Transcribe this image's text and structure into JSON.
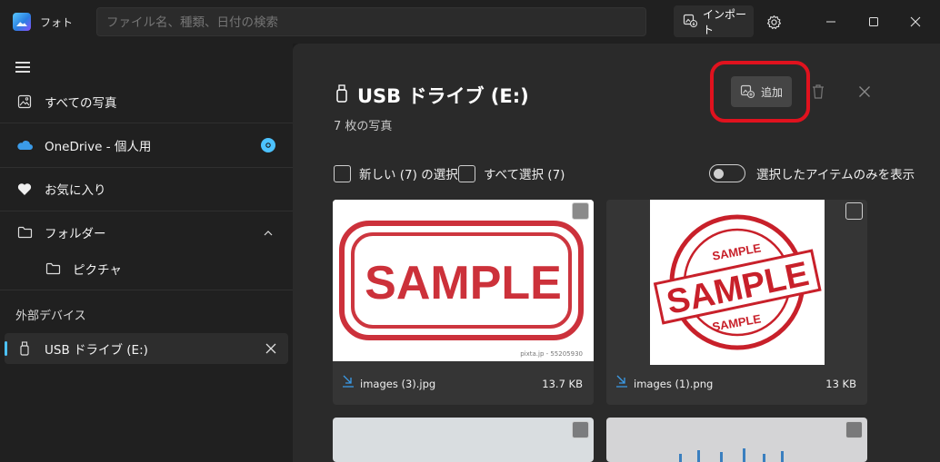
{
  "app": {
    "title": "フォト"
  },
  "search": {
    "placeholder": "ファイル名、種類、日付の検索"
  },
  "titlebar": {
    "import_label": "インポート"
  },
  "sidebar": {
    "all_photos": "すべての写真",
    "onedrive": "OneDrive - 個人用",
    "favorites": "お気に入り",
    "folders": "フォルダー",
    "pictures": "ピクチャ",
    "external_devices": "外部デバイス",
    "usb_drive": "USB ドライブ (E:)"
  },
  "main": {
    "title": "USB ドライブ (E:)",
    "subtitle": "7 枚の写真",
    "add_label": "追加",
    "select_new": "新しい (7) の選択",
    "select_all": "すべて選択 (7)",
    "show_selected_only": "選択したアイテムのみを表示"
  },
  "photos": [
    {
      "name": "images (3).jpg",
      "size": "13.7 KB",
      "stamp_text": "SAMPLE",
      "watermark": "pixta.jp - 55205930"
    },
    {
      "name": "images (1).png",
      "size": "13 KB",
      "stamp_text": "SAMPLE",
      "stamp_ring_text": "SAMPLE"
    }
  ],
  "colors": {
    "accent": "#4cc2ff",
    "highlight": "#e0121e",
    "stamp_red": "#c8202a"
  }
}
